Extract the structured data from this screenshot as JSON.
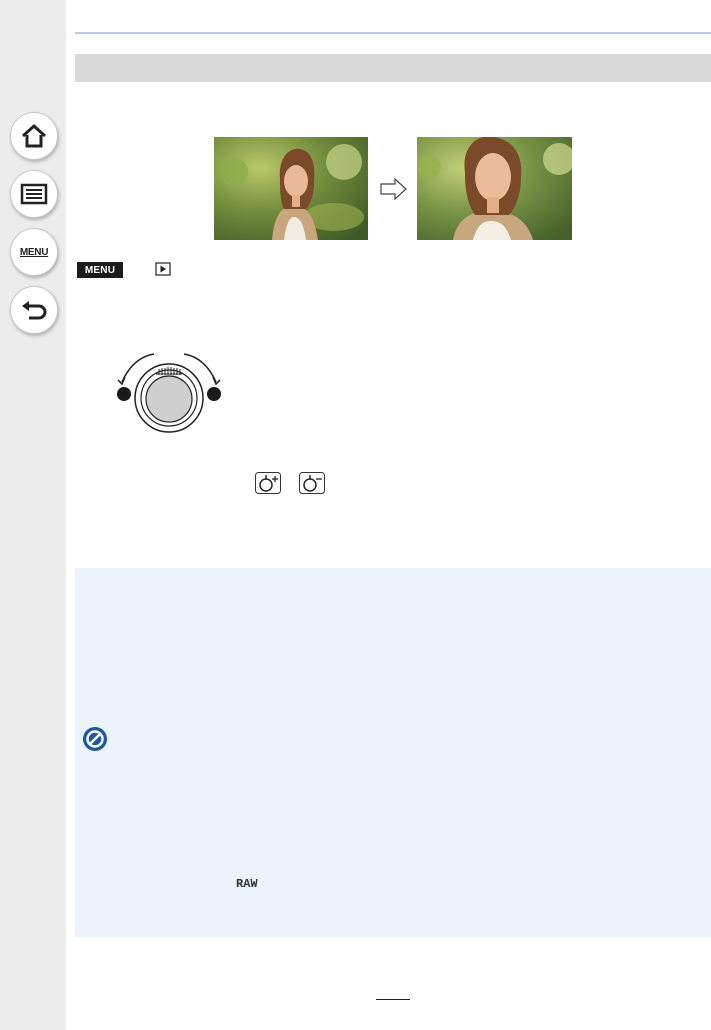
{
  "sidebar": {
    "buttons": [
      {
        "name": "home",
        "icon": "home-icon"
      },
      {
        "name": "contents",
        "icon": "list-icon"
      },
      {
        "name": "menu",
        "icon": "menu-text-icon",
        "label": "MENU"
      },
      {
        "name": "back",
        "icon": "back-arrow-icon"
      }
    ]
  },
  "header": {
    "menu_badge": "MENU",
    "playback_icon": "playback-icon"
  },
  "illustration": {
    "arrow_icon": "arrow-right-icon",
    "dial_icon": "control-dial-icon",
    "zoom_icons": [
      "zoom-in-icon",
      "zoom-out-icon"
    ]
  },
  "note_box": {
    "prohibit_icon": "not-available-icon",
    "raw_label": "RAW"
  },
  "colors": {
    "sidebar_bg": "#ececec",
    "info_box_bg": "#ebf3fc",
    "accent_blue": "#1e56a8",
    "band_gray": "#d9d9d9"
  }
}
